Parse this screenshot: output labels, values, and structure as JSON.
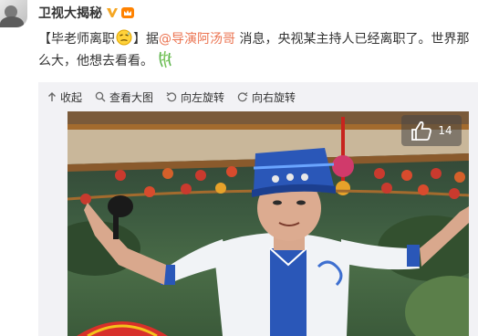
{
  "post": {
    "username": "卫视大揭秘",
    "text_part1": "【毕老师离职",
    "text_part2": "】据",
    "mention": "@导演阿汤哥",
    "text_part3": " 消息，央视某主持人已经离职了。世界那么大，他想去看看。"
  },
  "toolbar": {
    "collapse": "收起",
    "view_large": "查看大图",
    "rotate_left": "向左旋转",
    "rotate_right": "向右旋转"
  },
  "photo": {
    "like_count": "14"
  },
  "icons": [
    "avatar",
    "verified-v-icon",
    "crown-badge-icon",
    "sweat-face-emoji-icon",
    "leaf-emoji-icon",
    "collapse-arrow-icon",
    "magnifier-icon",
    "rotate-left-icon",
    "rotate-right-icon",
    "thumbs-up-icon"
  ],
  "colors": {
    "mention": "#eb7350",
    "verified": "#f5a623",
    "media_bg": "#f2f2f5",
    "costume_blue": "#2a57b8"
  }
}
